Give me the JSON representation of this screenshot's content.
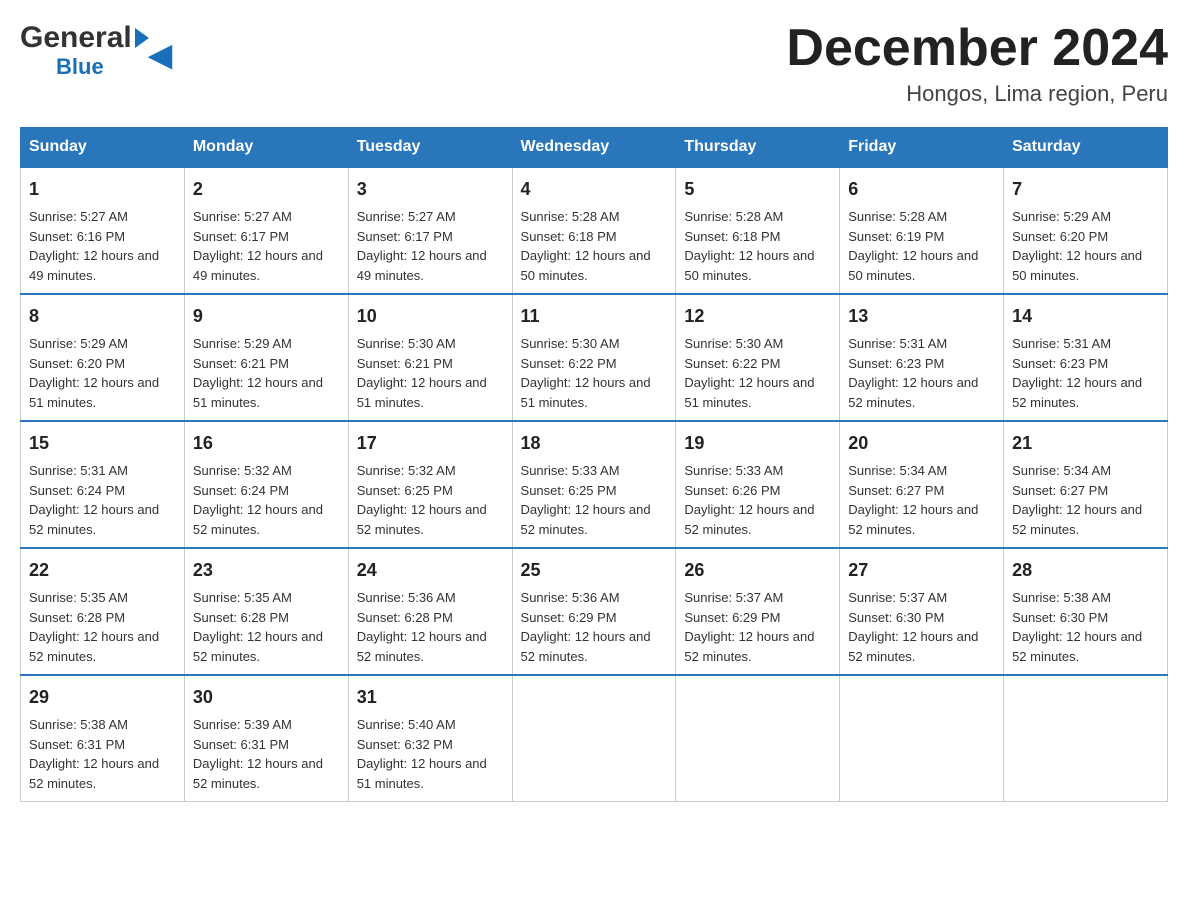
{
  "logo": {
    "general": "General",
    "blue": "Blue"
  },
  "title": "December 2024",
  "subtitle": "Hongos, Lima region, Peru",
  "days": [
    "Sunday",
    "Monday",
    "Tuesday",
    "Wednesday",
    "Thursday",
    "Friday",
    "Saturday"
  ],
  "weeks": [
    [
      {
        "num": "1",
        "sunrise": "5:27 AM",
        "sunset": "6:16 PM",
        "daylight": "12 hours and 49 minutes."
      },
      {
        "num": "2",
        "sunrise": "5:27 AM",
        "sunset": "6:17 PM",
        "daylight": "12 hours and 49 minutes."
      },
      {
        "num": "3",
        "sunrise": "5:27 AM",
        "sunset": "6:17 PM",
        "daylight": "12 hours and 49 minutes."
      },
      {
        "num": "4",
        "sunrise": "5:28 AM",
        "sunset": "6:18 PM",
        "daylight": "12 hours and 50 minutes."
      },
      {
        "num": "5",
        "sunrise": "5:28 AM",
        "sunset": "6:18 PM",
        "daylight": "12 hours and 50 minutes."
      },
      {
        "num": "6",
        "sunrise": "5:28 AM",
        "sunset": "6:19 PM",
        "daylight": "12 hours and 50 minutes."
      },
      {
        "num": "7",
        "sunrise": "5:29 AM",
        "sunset": "6:20 PM",
        "daylight": "12 hours and 50 minutes."
      }
    ],
    [
      {
        "num": "8",
        "sunrise": "5:29 AM",
        "sunset": "6:20 PM",
        "daylight": "12 hours and 51 minutes."
      },
      {
        "num": "9",
        "sunrise": "5:29 AM",
        "sunset": "6:21 PM",
        "daylight": "12 hours and 51 minutes."
      },
      {
        "num": "10",
        "sunrise": "5:30 AM",
        "sunset": "6:21 PM",
        "daylight": "12 hours and 51 minutes."
      },
      {
        "num": "11",
        "sunrise": "5:30 AM",
        "sunset": "6:22 PM",
        "daylight": "12 hours and 51 minutes."
      },
      {
        "num": "12",
        "sunrise": "5:30 AM",
        "sunset": "6:22 PM",
        "daylight": "12 hours and 51 minutes."
      },
      {
        "num": "13",
        "sunrise": "5:31 AM",
        "sunset": "6:23 PM",
        "daylight": "12 hours and 52 minutes."
      },
      {
        "num": "14",
        "sunrise": "5:31 AM",
        "sunset": "6:23 PM",
        "daylight": "12 hours and 52 minutes."
      }
    ],
    [
      {
        "num": "15",
        "sunrise": "5:31 AM",
        "sunset": "6:24 PM",
        "daylight": "12 hours and 52 minutes."
      },
      {
        "num": "16",
        "sunrise": "5:32 AM",
        "sunset": "6:24 PM",
        "daylight": "12 hours and 52 minutes."
      },
      {
        "num": "17",
        "sunrise": "5:32 AM",
        "sunset": "6:25 PM",
        "daylight": "12 hours and 52 minutes."
      },
      {
        "num": "18",
        "sunrise": "5:33 AM",
        "sunset": "6:25 PM",
        "daylight": "12 hours and 52 minutes."
      },
      {
        "num": "19",
        "sunrise": "5:33 AM",
        "sunset": "6:26 PM",
        "daylight": "12 hours and 52 minutes."
      },
      {
        "num": "20",
        "sunrise": "5:34 AM",
        "sunset": "6:27 PM",
        "daylight": "12 hours and 52 minutes."
      },
      {
        "num": "21",
        "sunrise": "5:34 AM",
        "sunset": "6:27 PM",
        "daylight": "12 hours and 52 minutes."
      }
    ],
    [
      {
        "num": "22",
        "sunrise": "5:35 AM",
        "sunset": "6:28 PM",
        "daylight": "12 hours and 52 minutes."
      },
      {
        "num": "23",
        "sunrise": "5:35 AM",
        "sunset": "6:28 PM",
        "daylight": "12 hours and 52 minutes."
      },
      {
        "num": "24",
        "sunrise": "5:36 AM",
        "sunset": "6:28 PM",
        "daylight": "12 hours and 52 minutes."
      },
      {
        "num": "25",
        "sunrise": "5:36 AM",
        "sunset": "6:29 PM",
        "daylight": "12 hours and 52 minutes."
      },
      {
        "num": "26",
        "sunrise": "5:37 AM",
        "sunset": "6:29 PM",
        "daylight": "12 hours and 52 minutes."
      },
      {
        "num": "27",
        "sunrise": "5:37 AM",
        "sunset": "6:30 PM",
        "daylight": "12 hours and 52 minutes."
      },
      {
        "num": "28",
        "sunrise": "5:38 AM",
        "sunset": "6:30 PM",
        "daylight": "12 hours and 52 minutes."
      }
    ],
    [
      {
        "num": "29",
        "sunrise": "5:38 AM",
        "sunset": "6:31 PM",
        "daylight": "12 hours and 52 minutes."
      },
      {
        "num": "30",
        "sunrise": "5:39 AM",
        "sunset": "6:31 PM",
        "daylight": "12 hours and 52 minutes."
      },
      {
        "num": "31",
        "sunrise": "5:40 AM",
        "sunset": "6:32 PM",
        "daylight": "12 hours and 51 minutes."
      },
      null,
      null,
      null,
      null
    ]
  ],
  "labels": {
    "sunrise": "Sunrise:",
    "sunset": "Sunset:",
    "daylight": "Daylight:"
  }
}
